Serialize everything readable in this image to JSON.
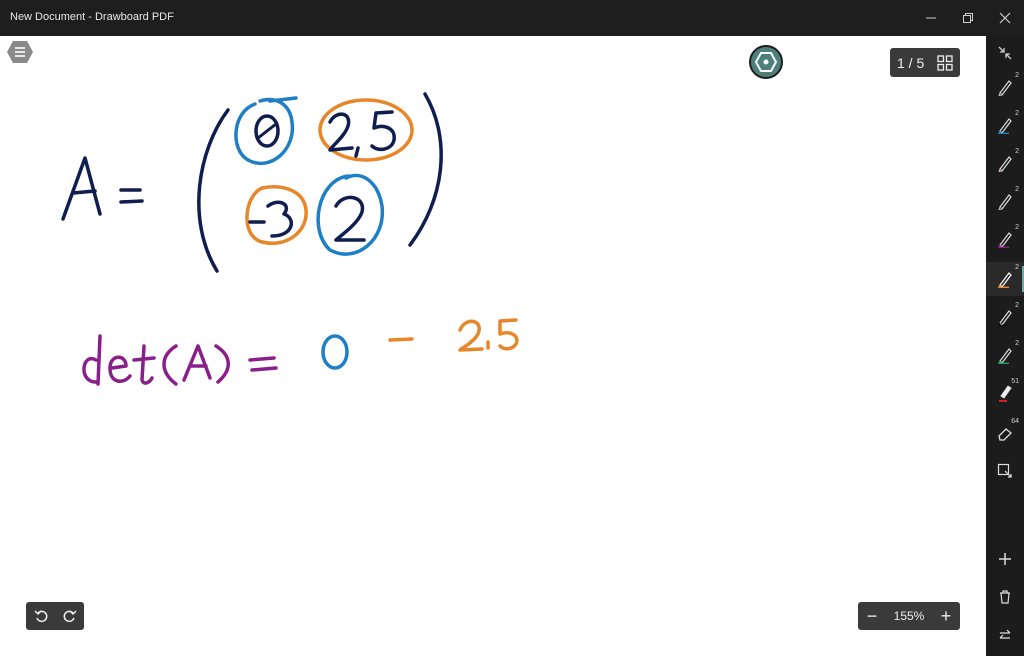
{
  "window": {
    "title": "New Document - Drawboard PDF"
  },
  "page_indicator": {
    "text": "1 / 5"
  },
  "zoom": {
    "value": "155%"
  },
  "tools": [
    {
      "name": "pen-1",
      "badge": "2"
    },
    {
      "name": "pen-2",
      "badge": "2"
    },
    {
      "name": "pen-3",
      "badge": "2"
    },
    {
      "name": "pen-4",
      "badge": "2"
    },
    {
      "name": "pen-5",
      "badge": "2"
    },
    {
      "name": "pen-6",
      "badge": "2"
    },
    {
      "name": "pen-7",
      "badge": "2"
    },
    {
      "name": "pen-8",
      "badge": "2"
    },
    {
      "name": "highlighter",
      "badge": "51"
    },
    {
      "name": "eraser",
      "badge": "64"
    }
  ],
  "colors": {
    "ink_navy": "#0f1d4f",
    "ink_blue": "#1e7fc4",
    "ink_orange": "#e8862a",
    "ink_purple": "#8a1f8c",
    "accent_teal": "#4d7f7b"
  }
}
